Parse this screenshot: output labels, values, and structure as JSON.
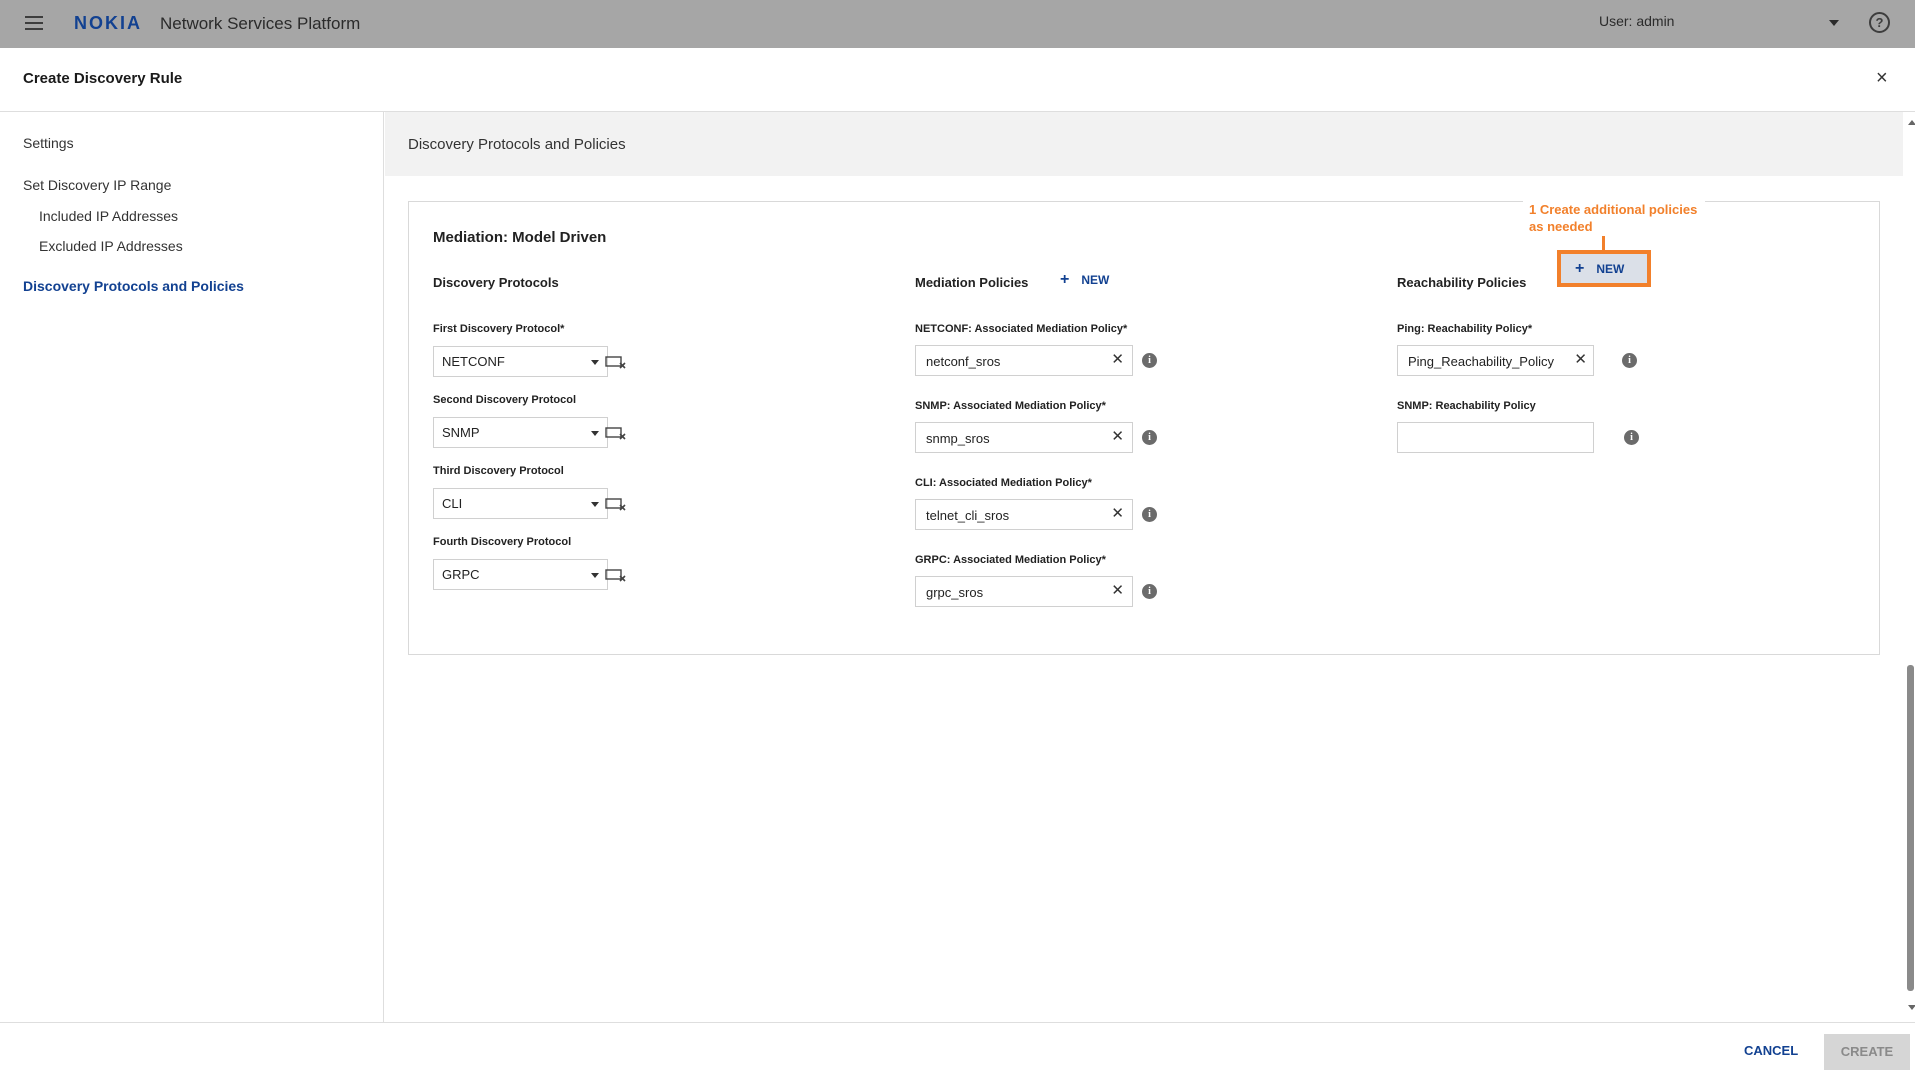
{
  "topbar": {
    "brand": "NOKIA",
    "app_title": "Network Services Platform",
    "user_label": "User: admin",
    "help_glyph": "?"
  },
  "dialog": {
    "title": "Create Discovery Rule",
    "close_glyph": "×"
  },
  "nav": {
    "items": [
      {
        "label": "Settings"
      },
      {
        "label": "Set Discovery IP Range"
      },
      {
        "label": "Included IP Addresses"
      },
      {
        "label": "Excluded IP Addresses"
      },
      {
        "label": "Discovery Protocols and Policies"
      }
    ]
  },
  "section": {
    "title": "Discovery Protocols and Policies"
  },
  "card": {
    "title": "Mediation: Model Driven",
    "protocols": {
      "title": "Discovery Protocols",
      "fields": [
        {
          "label": "First Discovery Protocol*",
          "value": "NETCONF"
        },
        {
          "label": "Second Discovery Protocol",
          "value": "SNMP"
        },
        {
          "label": "Third Discovery Protocol",
          "value": "CLI"
        },
        {
          "label": "Fourth Discovery Protocol",
          "value": "GRPC"
        }
      ]
    },
    "mediation": {
      "title": "Mediation Policies",
      "new_label": "NEW",
      "fields": [
        {
          "label": "NETCONF: Associated Mediation Policy*",
          "value": "netconf_sros"
        },
        {
          "label": "SNMP: Associated Mediation Policy*",
          "value": "snmp_sros"
        },
        {
          "label": "CLI: Associated Mediation Policy*",
          "value": "telnet_cli_sros"
        },
        {
          "label": "GRPC: Associated Mediation Policy*",
          "value": "grpc_sros"
        }
      ]
    },
    "reachability": {
      "title": "Reachability Policies",
      "new_label": "NEW",
      "fields": [
        {
          "label": "Ping: Reachability Policy*",
          "value": "Ping_Reachability_Policy"
        },
        {
          "label": "SNMP: Reachability Policy",
          "value": ""
        }
      ]
    },
    "callout": "1 Create additional policies as needed"
  },
  "footer": {
    "cancel_label": "CANCEL",
    "create_label": "CREATE"
  },
  "colors": {
    "brand_blue": "#124191",
    "highlight_orange": "#f2802b",
    "topbar_gray": "#a6a6a6"
  },
  "icons": {
    "menu": "hamburger-icon",
    "help": "help-icon",
    "close": "close-icon",
    "dropdown": "caret-down-icon",
    "clear_field": "clear-field-icon",
    "info": "info-icon",
    "add": "plus-icon"
  }
}
